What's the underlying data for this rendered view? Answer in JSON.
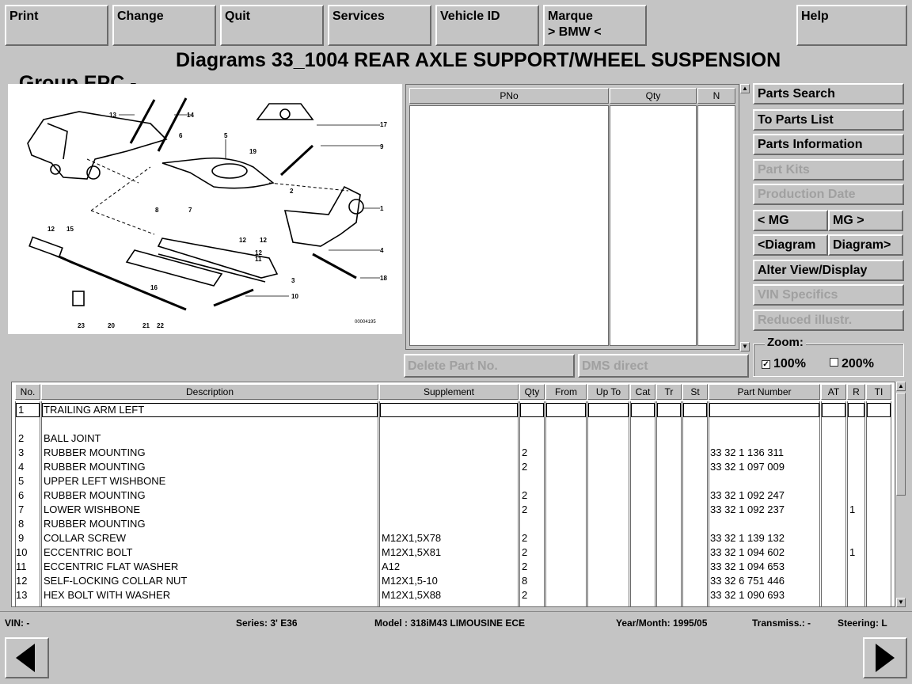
{
  "menu": {
    "print": "Print",
    "change": "Change",
    "quit": "Quit",
    "services": "Services",
    "vehicle_id": "Vehicle ID",
    "marque_label": "Marque",
    "marque_value": "> BMW <",
    "help": "Help"
  },
  "title": {
    "app": "Group EPC -",
    "diagram": "Diagrams 33_1004 REAR AXLE SUPPORT/WHEEL SUSPENSION"
  },
  "diagram": {
    "callouts": [
      "1",
      "2",
      "3",
      "4",
      "5",
      "6",
      "7",
      "8",
      "9",
      "10",
      "11",
      "12",
      "13",
      "14",
      "15",
      "16",
      "17",
      "18",
      "19",
      "20",
      "21",
      "22",
      "23"
    ],
    "image_code": "00004195"
  },
  "pno_table": {
    "headers": [
      "PNo",
      "Qty",
      "N"
    ]
  },
  "side_buttons": {
    "parts_search": "Parts Search",
    "to_parts_list": "To Parts List",
    "parts_information": "Parts Information",
    "part_kits": "Part Kits",
    "production_date": "Production Date",
    "prev_mg": "< MG",
    "next_mg": "MG >",
    "prev_diagram": "<Diagram",
    "next_diagram": "Diagram>",
    "alter_view": "Alter View/Display",
    "vin_specifics": "VIN Specifics",
    "reduced_illustr": "Reduced illustr."
  },
  "lower_buttons": {
    "delete_part": "Delete Part No.",
    "dms_direct": "DMS direct"
  },
  "zoom": {
    "label": "Zoom:",
    "opt100": "100%",
    "opt100_checked": "✓",
    "opt200": "200%"
  },
  "parts_table": {
    "headers": {
      "no": "No.",
      "description": "Description",
      "supplement": "Supplement",
      "qty": "Qty",
      "from": "From",
      "upto": "Up To",
      "cat": "Cat",
      "tr": "Tr",
      "st": "St",
      "part_number": "Part Number",
      "at": "AT",
      "r": "R",
      "ti": "TI"
    },
    "rows": [
      {
        "no": "1",
        "description": "TRAILING ARM LEFT",
        "supplement": "",
        "qty": "",
        "part_number": "",
        "r": ""
      },
      {
        "no": "2",
        "description": "BALL JOINT",
        "supplement": "",
        "qty": "",
        "part_number": "",
        "r": ""
      },
      {
        "no": "3",
        "description": "RUBBER MOUNTING",
        "supplement": "",
        "qty": "2",
        "part_number": "33 32 1 136 311",
        "r": ""
      },
      {
        "no": "4",
        "description": "RUBBER MOUNTING",
        "supplement": "",
        "qty": "2",
        "part_number": "33 32 1 097 009",
        "r": ""
      },
      {
        "no": "5",
        "description": "UPPER LEFT WISHBONE",
        "supplement": "",
        "qty": "",
        "part_number": "",
        "r": ""
      },
      {
        "no": "6",
        "description": "RUBBER MOUNTING",
        "supplement": "",
        "qty": "2",
        "part_number": "33 32 1 092 247",
        "r": ""
      },
      {
        "no": "7",
        "description": "LOWER WISHBONE",
        "supplement": "",
        "qty": "2",
        "part_number": "33 32 1 092 237",
        "r": "1"
      },
      {
        "no": "8",
        "description": "RUBBER MOUNTING",
        "supplement": "",
        "qty": "",
        "part_number": "",
        "r": ""
      },
      {
        "no": "9",
        "description": "COLLAR SCREW",
        "supplement": "M12X1,5X78",
        "qty": "2",
        "part_number": "33 32 1 139 132",
        "r": ""
      },
      {
        "no": "10",
        "description": "ECCENTRIC BOLT",
        "supplement": "M12X1,5X81",
        "qty": "2",
        "part_number": "33 32 1 094 602",
        "r": "1"
      },
      {
        "no": "11",
        "description": "ECCENTRIC FLAT WASHER",
        "supplement": "A12",
        "qty": "2",
        "part_number": "33 32 1 094 653",
        "r": ""
      },
      {
        "no": "12",
        "description": "SELF-LOCKING COLLAR NUT",
        "supplement": "M12X1,5-10",
        "qty": "8",
        "part_number": "33 32 6 751 446",
        "r": ""
      },
      {
        "no": "13",
        "description": "HEX BOLT WITH WASHER",
        "supplement": "M12X1,5X88",
        "qty": "2",
        "part_number": "33 32 1 090 693",
        "r": ""
      }
    ]
  },
  "status": {
    "vin": "VIN: -",
    "series": "Series: 3' E36",
    "model": "Model : 318iM43 LIMOUSINE ECE",
    "year_month": "Year/Month: 1995/05",
    "transmission": "Transmiss.: -",
    "steering": "Steering: L"
  }
}
